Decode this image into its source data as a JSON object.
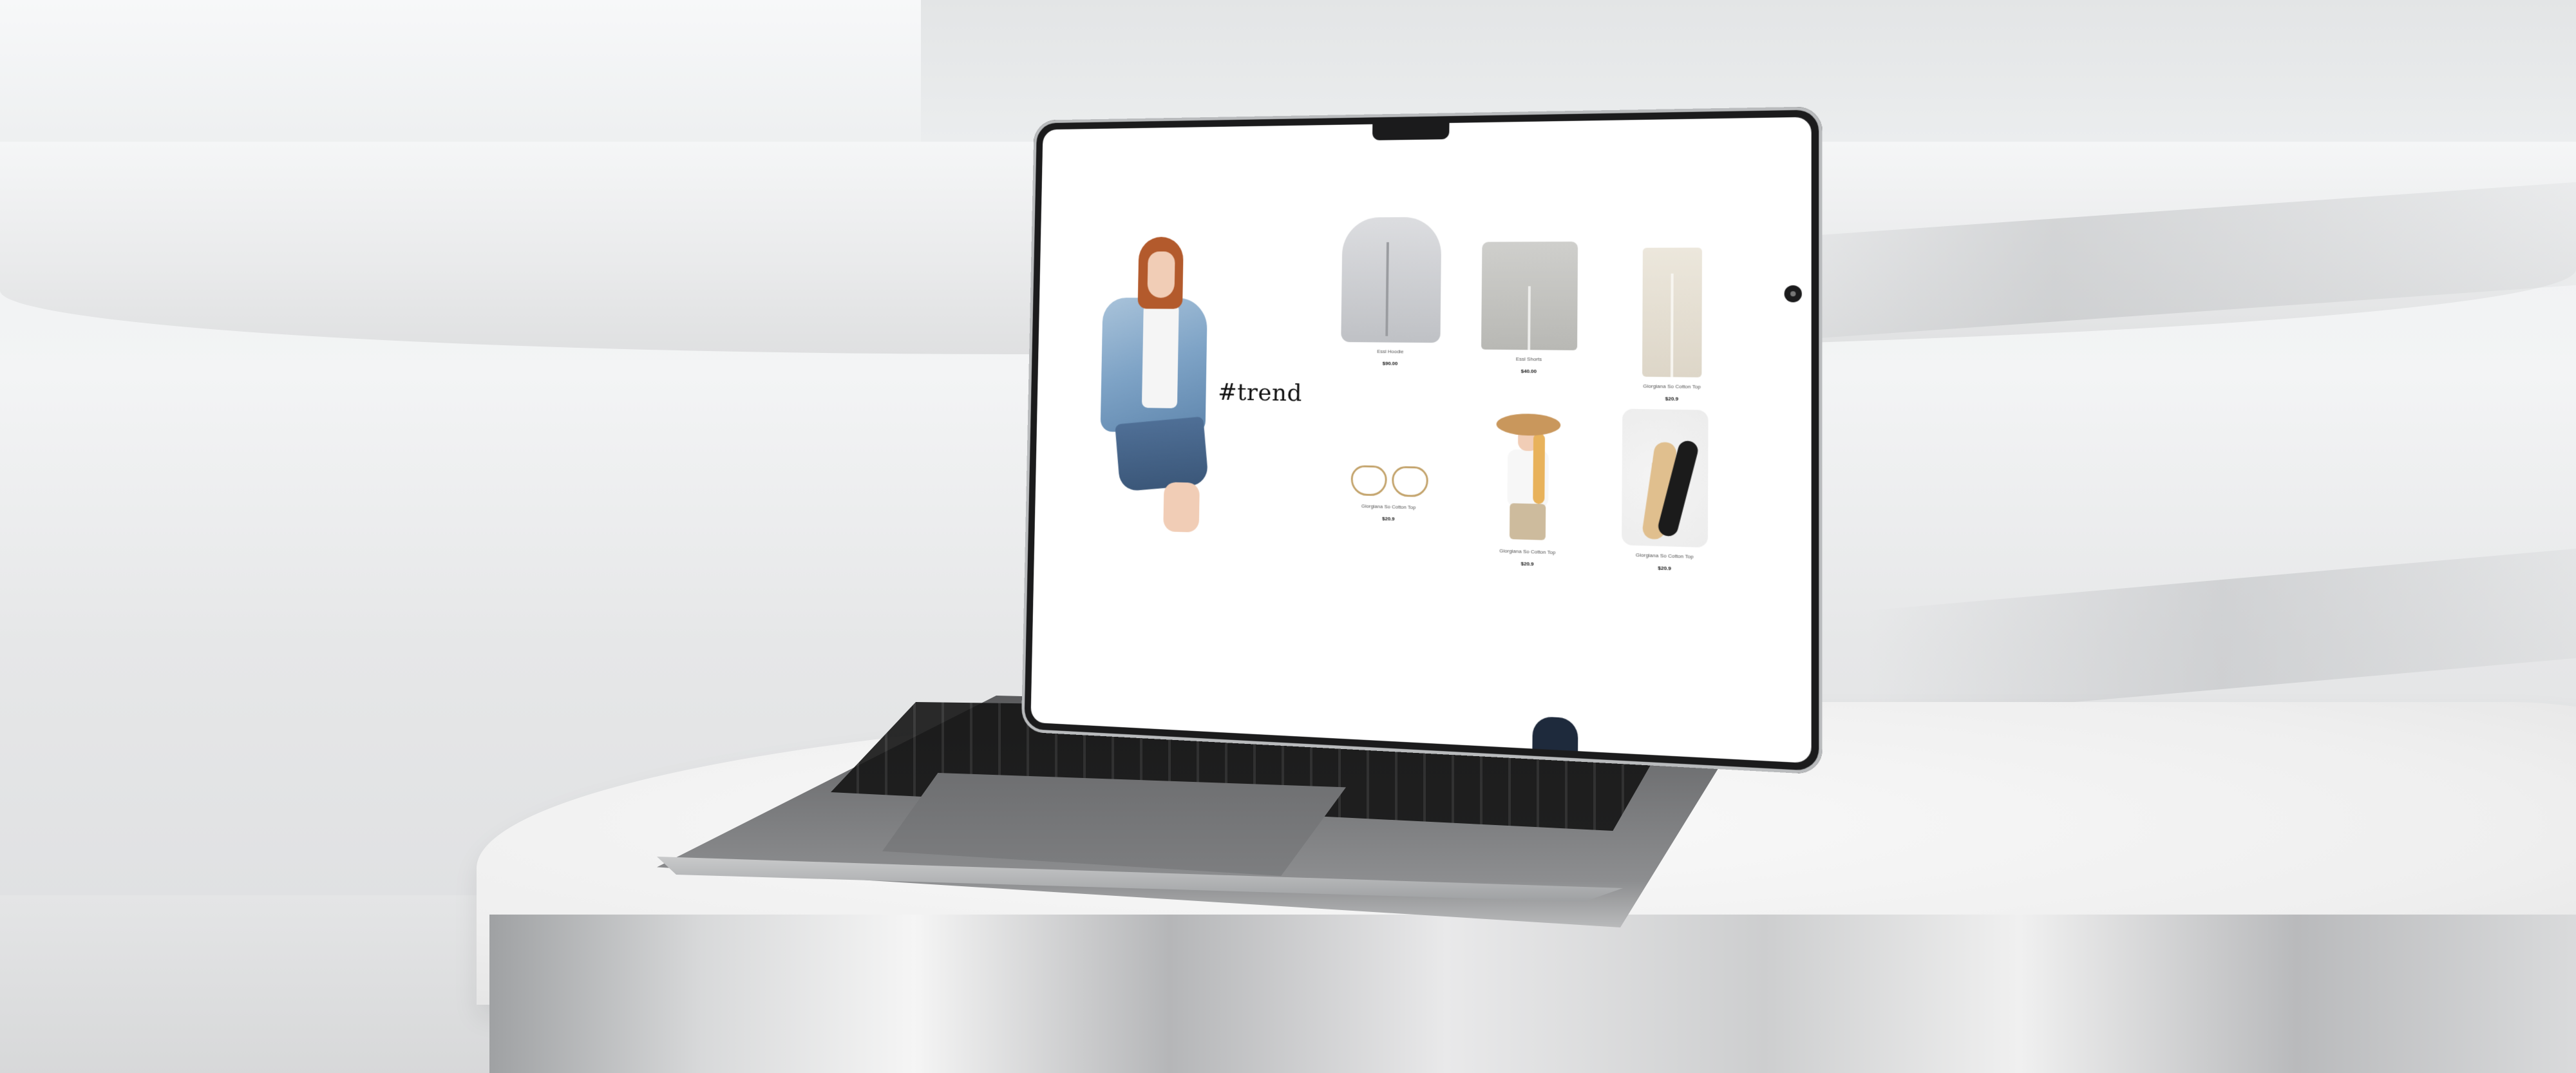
{
  "hero": {
    "tag_text": "#trend"
  },
  "products": [
    {
      "name": "Essl Hoodie",
      "price": "$90.00",
      "image_icon": "hoodie"
    },
    {
      "name": "Essl Shorts",
      "price": "$40.00",
      "image_icon": "shorts"
    },
    {
      "name": "Giorgiana So Cotton Top",
      "price": "$20.9",
      "image_icon": "wide-pants"
    },
    {
      "name": "Giorgiana So Cotton Top",
      "price": "$20.9",
      "image_icon": "glasses"
    },
    {
      "name": "Giorgiana So Cotton Top",
      "price": "$20.9",
      "image_icon": "girl-in-hat"
    },
    {
      "name": "Giorgiana So Cotton Top",
      "price": "$20.9",
      "image_icon": "socks"
    }
  ],
  "colors": {
    "screen_bg": "#ffffff",
    "laptop_bezel": "#1b1b1c",
    "price_text": "#111111"
  }
}
